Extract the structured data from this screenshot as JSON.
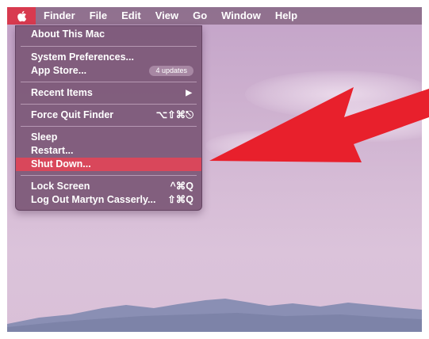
{
  "menubar": {
    "app_name": "Finder",
    "items": [
      "File",
      "Edit",
      "View",
      "Go",
      "Window",
      "Help"
    ]
  },
  "apple_menu": {
    "about": "About This Mac",
    "system_preferences": "System Preferences...",
    "app_store": "App Store...",
    "app_store_badge": "4 updates",
    "recent_items": "Recent Items",
    "recent_items_arrow": "▶",
    "force_quit": "Force Quit Finder",
    "force_quit_shortcut": "⌥⇧⌘⎋",
    "sleep": "Sleep",
    "restart": "Restart...",
    "shut_down": "Shut Down...",
    "lock_screen": "Lock Screen",
    "lock_screen_shortcut": "^⌘Q",
    "log_out": "Log Out Martyn Casserly...",
    "log_out_shortcut": "⇧⌘Q"
  },
  "colors": {
    "highlight": "#d9475b",
    "apple_cell": "#d83a4f",
    "arrow": "#e8202c",
    "menu_bg": "#765272"
  }
}
